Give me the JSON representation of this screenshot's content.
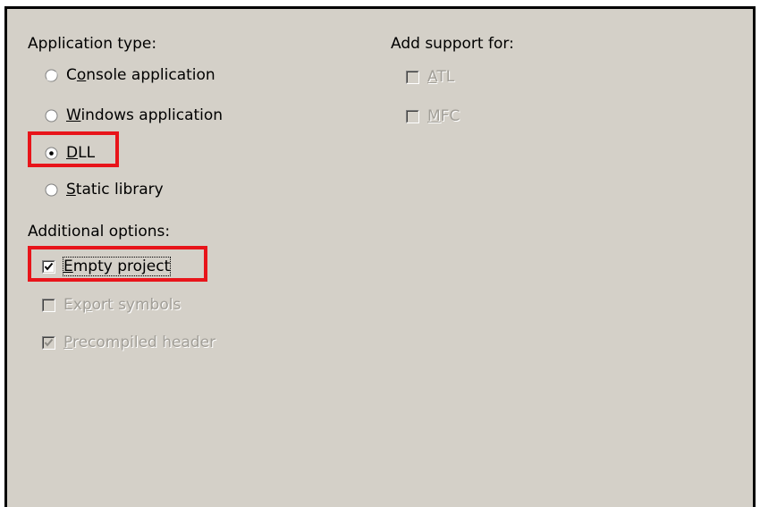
{
  "application_type": {
    "heading": "Application type:",
    "options": [
      {
        "pre": "C",
        "mn": "o",
        "post": "nsole application",
        "selected": false
      },
      {
        "pre": "",
        "mn": "W",
        "post": "indows application",
        "selected": false
      },
      {
        "pre": "",
        "mn": "D",
        "post": "LL",
        "selected": true
      },
      {
        "pre": "",
        "mn": "S",
        "post": "tatic library",
        "selected": false
      }
    ]
  },
  "additional_options": {
    "heading": "Additional options:",
    "options": [
      {
        "pre": "",
        "mn": "E",
        "post": "mpty project",
        "checked": true,
        "enabled": true
      },
      {
        "pre": "Ex",
        "mn": "p",
        "post": "ort symbols",
        "checked": false,
        "enabled": false
      },
      {
        "pre": "",
        "mn": "P",
        "post": "recompiled header",
        "checked": true,
        "enabled": false
      }
    ]
  },
  "add_support": {
    "heading": "Add support for:",
    "options": [
      {
        "pre": "",
        "mn": "A",
        "post": "TL",
        "checked": false,
        "enabled": false
      },
      {
        "pre": "",
        "mn": "M",
        "post": "FC",
        "checked": false,
        "enabled": false
      }
    ]
  },
  "colors": {
    "panel_bg": "#d4d0c8",
    "highlight": "#e8141a",
    "disabled_text": "#a19e97"
  }
}
